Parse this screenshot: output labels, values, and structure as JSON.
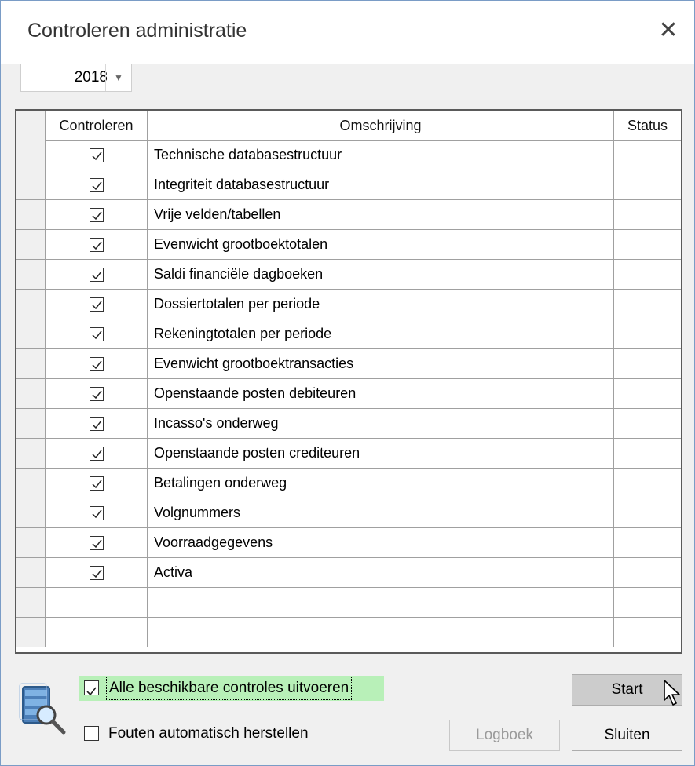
{
  "window": {
    "title": "Controleren administratie",
    "close_glyph": "✕"
  },
  "year_select": {
    "value": "2018",
    "arrow_glyph": "▼"
  },
  "grid": {
    "columns": [
      "Controleren",
      "Omschrijving",
      "Status"
    ],
    "rows": [
      {
        "checked": true,
        "description": "Technische databasestructuur",
        "status": ""
      },
      {
        "checked": true,
        "description": "Integriteit databasestructuur",
        "status": ""
      },
      {
        "checked": true,
        "description": "Vrije velden/tabellen",
        "status": ""
      },
      {
        "checked": true,
        "description": "Evenwicht grootboektotalen",
        "status": ""
      },
      {
        "checked": true,
        "description": "Saldi financiële dagboeken",
        "status": ""
      },
      {
        "checked": true,
        "description": "Dossiertotalen per periode",
        "status": ""
      },
      {
        "checked": true,
        "description": "Rekeningtotalen per periode",
        "status": ""
      },
      {
        "checked": true,
        "description": "Evenwicht grootboektransacties",
        "status": ""
      },
      {
        "checked": true,
        "description": "Openstaande posten debiteuren",
        "status": ""
      },
      {
        "checked": true,
        "description": "Incasso's onderweg",
        "status": ""
      },
      {
        "checked": true,
        "description": "Openstaande posten crediteuren",
        "status": ""
      },
      {
        "checked": true,
        "description": "Betalingen onderweg",
        "status": ""
      },
      {
        "checked": true,
        "description": "Volgnummers",
        "status": ""
      },
      {
        "checked": true,
        "description": "Voorraadgegevens",
        "status": ""
      },
      {
        "checked": true,
        "description": "Activa",
        "status": ""
      }
    ]
  },
  "options": {
    "run_all": {
      "label": "Alle beschikbare controles uitvoeren",
      "checked": true
    },
    "auto_fix": {
      "label": "Fouten automatisch herstellen",
      "checked": false
    }
  },
  "buttons": {
    "start": "Start",
    "logbook": "Logboek",
    "close": "Sluiten"
  },
  "icons": {
    "database": "database-search-icon",
    "cursor": "mouse-pointer-icon"
  }
}
